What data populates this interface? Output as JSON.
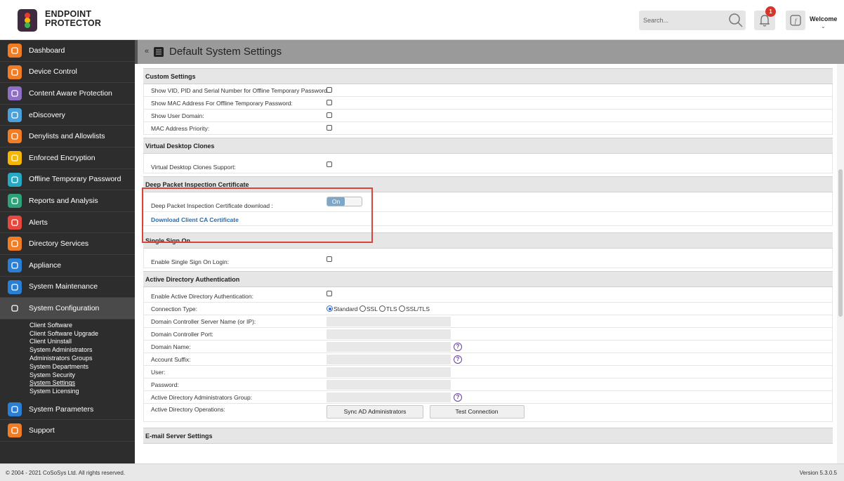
{
  "brand": {
    "line1": "ENDPOINT",
    "line2": "PROTECTOR"
  },
  "header": {
    "search_placeholder": "Search...",
    "notification_count": "1",
    "welcome": "Welcome",
    "caret": "⌄"
  },
  "sidebar": {
    "items": [
      {
        "label": "Dashboard",
        "icon": "dashboard-icon",
        "color": "#f07d24"
      },
      {
        "label": "Device Control",
        "icon": "device-control-icon",
        "color": "#f07d24"
      },
      {
        "label": "Content Aware Protection",
        "icon": "content-aware-icon",
        "color": "#8e6fc5"
      },
      {
        "label": "eDiscovery",
        "icon": "ediscovery-icon",
        "color": "#4aa0d8"
      },
      {
        "label": "Denylists and Allowlists",
        "icon": "denylists-icon",
        "color": "#f07d24"
      },
      {
        "label": "Enforced Encryption",
        "icon": "encryption-icon",
        "color": "#f5b700"
      },
      {
        "label": "Offline Temporary Password",
        "icon": "offline-password-icon",
        "color": "#26a9c4"
      },
      {
        "label": "Reports and Analysis",
        "icon": "reports-icon",
        "color": "#2ea37a"
      },
      {
        "label": "Alerts",
        "icon": "alerts-icon",
        "color": "#e8473d"
      },
      {
        "label": "Directory Services",
        "icon": "directory-icon",
        "color": "#f07d24"
      },
      {
        "label": "Appliance",
        "icon": "appliance-icon",
        "color": "#2a7fd4"
      },
      {
        "label": "System Maintenance",
        "icon": "maintenance-icon",
        "color": "#2a7fd4"
      },
      {
        "label": "System Configuration",
        "icon": "configuration-icon",
        "color": "#4a4a4a"
      }
    ],
    "submenu": [
      "Client Software",
      "Client Software Upgrade",
      "Client Uninstall",
      "System Administrators",
      "Administrators Groups",
      "System Departments",
      "System Security",
      "System Settings",
      "System Licensing"
    ],
    "bottom_items": [
      {
        "label": "System Parameters",
        "icon": "parameters-icon",
        "color": "#2a7fd4"
      },
      {
        "label": "Support",
        "icon": "support-icon",
        "color": "#f07d24"
      }
    ]
  },
  "page": {
    "back": "«",
    "title": "Default System Settings"
  },
  "custom_settings": {
    "heading": "Custom Settings",
    "rows": [
      "Show VID, PID and Serial Number for Offline Temporary Password:",
      "Show MAC Address For Offline Temporary Password:",
      "Show User Domain:",
      "MAC Address Priority:"
    ]
  },
  "virtual_desktop": {
    "heading": "Virtual Desktop Clones",
    "row": "Virtual Desktop Clones Support:"
  },
  "dpi": {
    "heading": "Deep Packet Inspection Certificate",
    "row": "Deep Packet Inspection Certificate download :",
    "toggle": "On",
    "link": "Download Client CA Certificate"
  },
  "sso": {
    "heading": "Single Sign On",
    "row": "Enable Single Sign On Login:"
  },
  "ad": {
    "heading": "Active Directory Authentication",
    "enable": "Enable Active Directory Authentication:",
    "connection_type": "Connection Type:",
    "radios": [
      "Standard",
      "SSL",
      "TLS",
      "SSL/TLS"
    ],
    "selected_radio": "Standard",
    "server": "Domain Controller Server Name (or IP):",
    "port": "Domain Controller Port:",
    "domain_name": "Domain Name:",
    "account_suffix": "Account Suffix:",
    "user": "User:",
    "password": "Password:",
    "admin_group": "Active Directory Administrators Group:",
    "operations": "Active Directory Operations:",
    "sync_button": "Sync AD Administrators",
    "test_button": "Test Connection",
    "help": "?"
  },
  "email": {
    "heading": "E-mail Server Settings"
  },
  "footer": {
    "copyright": "© 2004 - 2021 CoSoSys Ltd. All rights reserved.",
    "version": "Version 5.3.0.5"
  }
}
